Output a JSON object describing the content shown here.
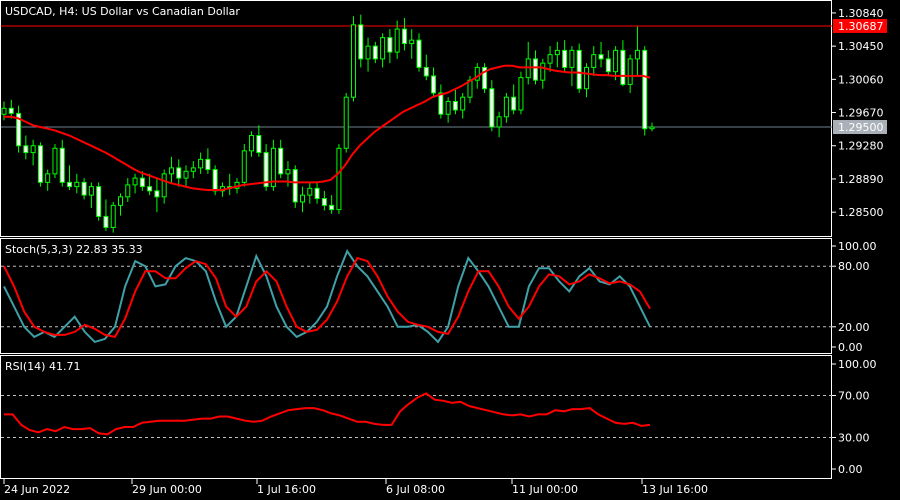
{
  "chart_data": [
    {
      "type": "candlestick",
      "symbol": "USDCAD",
      "timeframe": "H4",
      "title": "USDCAD, H4:  US Dollar vs Canadian Dollar",
      "ylim": [
        1.2822,
        1.3098
      ],
      "y_ticks": [
        "1.30840",
        "1.30450",
        "1.30060",
        "1.29670",
        "1.29280",
        "1.28890",
        "1.28500"
      ],
      "x_ticks": [
        "24 Jun 2022",
        "29 Jun 00:00",
        "1 Jul 16:00",
        "6 Jul 08:00",
        "11 Jul 00:00",
        "13 Jul 16:00"
      ],
      "bid_line": {
        "label": "1.29500",
        "value": 1.295
      },
      "ask_line": {
        "label": "1.30687",
        "value": 1.30687
      },
      "colors": {
        "bull_candle": "#00ff00",
        "ma_line": "#ff0000",
        "bid_line": "#708090",
        "ask_line": "#ff0000",
        "grid": "#c0c0c0"
      },
      "candles": [
        [
          1.2965,
          1.298,
          1.2958,
          1.2972
        ],
        [
          1.2972,
          1.2982,
          1.296,
          1.2966
        ],
        [
          1.2966,
          1.2975,
          1.292,
          1.2928
        ],
        [
          1.2928,
          1.294,
          1.2912,
          1.292
        ],
        [
          1.292,
          1.2935,
          1.2905,
          1.2928
        ],
        [
          1.2928,
          1.2932,
          1.288,
          1.2885
        ],
        [
          1.2885,
          1.29,
          1.2875,
          1.2895
        ],
        [
          1.2895,
          1.293,
          1.289,
          1.2925
        ],
        [
          1.2925,
          1.2935,
          1.288,
          1.2885
        ],
        [
          1.2885,
          1.2905,
          1.2876,
          1.288
        ],
        [
          1.288,
          1.2895,
          1.2872,
          1.2885
        ],
        [
          1.2885,
          1.289,
          1.2865,
          1.287
        ],
        [
          1.287,
          1.2885,
          1.2855,
          1.288
        ],
        [
          1.288,
          1.2885,
          1.284,
          1.2845
        ],
        [
          1.2845,
          1.2865,
          1.2828,
          1.2832
        ],
        [
          1.2832,
          1.2862,
          1.2826,
          1.2858
        ],
        [
          1.2858,
          1.2872,
          1.2846,
          1.2868
        ],
        [
          1.2868,
          1.289,
          1.2862,
          1.2882
        ],
        [
          1.2882,
          1.2895,
          1.2872,
          1.289
        ],
        [
          1.289,
          1.2898,
          1.2875,
          1.288
        ],
        [
          1.288,
          1.2895,
          1.287,
          1.2875
        ],
        [
          1.2875,
          1.289,
          1.285,
          1.2868
        ],
        [
          1.2868,
          1.29,
          1.286,
          1.2895
        ],
        [
          1.2895,
          1.2915,
          1.2885,
          1.2902
        ],
        [
          1.2902,
          1.2912,
          1.288,
          1.289
        ],
        [
          1.289,
          1.2905,
          1.288,
          1.2898
        ],
        [
          1.2898,
          1.291,
          1.289,
          1.2902
        ],
        [
          1.2902,
          1.292,
          1.2895,
          1.2912
        ],
        [
          1.2912,
          1.2925,
          1.2895,
          1.29
        ],
        [
          1.29,
          1.2905,
          1.287,
          1.2875
        ],
        [
          1.2875,
          1.2885,
          1.2868,
          1.288
        ],
        [
          1.288,
          1.2895,
          1.287,
          1.2878
        ],
        [
          1.2878,
          1.289,
          1.2872,
          1.2885
        ],
        [
          1.2885,
          1.293,
          1.288,
          1.2922
        ],
        [
          1.2922,
          1.2945,
          1.2915,
          1.294
        ],
        [
          1.294,
          1.2952,
          1.2915,
          1.292
        ],
        [
          1.292,
          1.293,
          1.2875,
          1.288
        ],
        [
          1.288,
          1.2935,
          1.2875,
          1.2925
        ],
        [
          1.2925,
          1.2935,
          1.289,
          1.2895
        ],
        [
          1.2895,
          1.291,
          1.288,
          1.29
        ],
        [
          1.29,
          1.2905,
          1.2855,
          1.2862
        ],
        [
          1.2862,
          1.288,
          1.285,
          1.287
        ],
        [
          1.287,
          1.2885,
          1.286,
          1.2878
        ],
        [
          1.2878,
          1.2885,
          1.286,
          1.2866
        ],
        [
          1.2866,
          1.2875,
          1.2852,
          1.2858
        ],
        [
          1.2858,
          1.287,
          1.2848,
          1.2853
        ],
        [
          1.2853,
          1.293,
          1.2848,
          1.2925
        ],
        [
          1.2925,
          1.299,
          1.292,
          1.2985
        ],
        [
          1.2985,
          1.308,
          1.298,
          1.307
        ],
        [
          1.307,
          1.3082,
          1.302,
          1.303
        ],
        [
          1.303,
          1.3055,
          1.3015,
          1.3045
        ],
        [
          1.3045,
          1.305,
          1.3025,
          1.303
        ],
        [
          1.303,
          1.306,
          1.302,
          1.3055
        ],
        [
          1.3055,
          1.3065,
          1.3025,
          1.3038
        ],
        [
          1.3038,
          1.3075,
          1.303,
          1.3065
        ],
        [
          1.3065,
          1.3078,
          1.304,
          1.3048
        ],
        [
          1.3048,
          1.3065,
          1.303,
          1.3052
        ],
        [
          1.3052,
          1.306,
          1.3015,
          1.302
        ],
        [
          1.302,
          1.3035,
          1.3005,
          1.301
        ],
        [
          1.301,
          1.302,
          1.2985,
          1.299
        ],
        [
          1.299,
          1.3,
          1.296,
          1.2965
        ],
        [
          1.2965,
          1.2985,
          1.2955,
          1.298
        ],
        [
          1.298,
          1.2995,
          1.2965,
          1.297
        ],
        [
          1.297,
          1.299,
          1.296,
          1.2985
        ],
        [
          1.2985,
          1.301,
          1.2978,
          1.3005
        ],
        [
          1.3005,
          1.3025,
          1.2995,
          1.302
        ],
        [
          1.302,
          1.3025,
          1.299,
          1.2995
        ],
        [
          1.2995,
          1.3005,
          1.2945,
          1.295
        ],
        [
          1.295,
          1.2968,
          1.2938,
          1.2962
        ],
        [
          1.2962,
          1.299,
          1.2955,
          1.2985
        ],
        [
          1.2985,
          1.3,
          1.2965,
          1.297
        ],
        [
          1.297,
          1.3015,
          1.2965,
          1.3008
        ],
        [
          1.3008,
          1.305,
          1.3,
          1.303
        ],
        [
          1.303,
          1.304,
          1.3,
          1.3005
        ],
        [
          1.3005,
          1.303,
          1.2995,
          1.3025
        ],
        [
          1.3025,
          1.3045,
          1.3015,
          1.3035
        ],
        [
          1.3035,
          1.305,
          1.302,
          1.304
        ],
        [
          1.304,
          1.3052,
          1.3015,
          1.302
        ],
        [
          1.302,
          1.3045,
          1.2998,
          1.304
        ],
        [
          1.304,
          1.3048,
          1.299,
          1.2995
        ],
        [
          1.2995,
          1.3025,
          1.2985,
          1.302
        ],
        [
          1.302,
          1.3045,
          1.301,
          1.3035
        ],
        [
          1.3035,
          1.305,
          1.302,
          1.303
        ],
        [
          1.303,
          1.304,
          1.301,
          1.3015
        ],
        [
          1.3015,
          1.3045,
          1.3005,
          1.304
        ],
        [
          1.304,
          1.3052,
          1.2998,
          1.3
        ],
        [
          1.3,
          1.3035,
          1.299,
          1.303
        ],
        [
          1.303,
          1.3068,
          1.301,
          1.304
        ],
        [
          1.304,
          1.3045,
          1.294,
          1.2948
        ],
        [
          1.2948,
          1.2955,
          1.2945,
          1.295
        ]
      ],
      "ma_values": [
        1.2962,
        1.2962,
        1.296,
        1.2956,
        1.2952,
        1.295,
        1.2948,
        1.2946,
        1.2943,
        1.294,
        1.2936,
        1.2932,
        1.2928,
        1.2924,
        1.292,
        1.2915,
        1.291,
        1.2905,
        1.29,
        1.2896,
        1.2893,
        1.289,
        1.2887,
        1.2884,
        1.2882,
        1.288,
        1.2878,
        1.2877,
        1.2876,
        1.2876,
        1.2876,
        1.2878,
        1.288,
        1.2882,
        1.2883,
        1.2884,
        1.2885,
        1.2886,
        1.2886,
        1.2886,
        1.2885,
        1.2885,
        1.2885,
        1.2885,
        1.2886,
        1.2888,
        1.2895,
        1.2905,
        1.2918,
        1.2928,
        1.2936,
        1.2944,
        1.295,
        1.2956,
        1.2962,
        1.2968,
        1.2972,
        1.2976,
        1.298,
        1.2985,
        1.2988,
        1.299,
        1.2994,
        1.2998,
        1.3003,
        1.3008,
        1.3014,
        1.3018,
        1.302,
        1.3022,
        1.3022,
        1.302,
        1.302,
        1.302,
        1.302,
        1.3018,
        1.3016,
        1.3015,
        1.3014,
        1.3014,
        1.3013,
        1.3012,
        1.3011,
        1.3011,
        1.301,
        1.301,
        1.301,
        1.301,
        1.301,
        1.3008
      ]
    },
    {
      "type": "line",
      "title": "Stoch(5,3,3) 22.83 35.33",
      "ylim": [
        0,
        100
      ],
      "y_ticks": [
        "100.00",
        "80.00",
        "20.00",
        "0.00"
      ],
      "levels": [
        80,
        20
      ],
      "series": [
        {
          "color": "#40a0a8",
          "values": [
            60,
            40,
            20,
            10,
            15,
            10,
            20,
            30,
            15,
            5,
            8,
            20,
            60,
            85,
            80,
            60,
            62,
            80,
            88,
            85,
            75,
            45,
            20,
            30,
            60,
            90,
            70,
            40,
            20,
            10,
            15,
            25,
            40,
            70,
            95,
            80,
            70,
            55,
            40,
            20,
            20,
            22,
            15,
            5,
            20,
            60,
            88,
            75,
            60,
            40,
            20,
            20,
            60,
            78,
            78,
            65,
            55,
            70,
            78,
            65,
            62,
            70,
            60,
            40,
            20
          ]
        },
        {
          "color": "#ff0000",
          "values": [
            80,
            60,
            35,
            20,
            15,
            12,
            12,
            15,
            22,
            18,
            12,
            10,
            28,
            55,
            75,
            75,
            68,
            68,
            78,
            85,
            82,
            68,
            40,
            30,
            40,
            65,
            75,
            65,
            40,
            20,
            15,
            17,
            27,
            45,
            70,
            88,
            85,
            70,
            50,
            35,
            25,
            22,
            20,
            15,
            13,
            30,
            55,
            75,
            75,
            60,
            40,
            28,
            40,
            60,
            72,
            70,
            62,
            65,
            72,
            68,
            63,
            65,
            62,
            55,
            38
          ]
        }
      ]
    },
    {
      "type": "line",
      "title": "RSI(14) 41.71",
      "ylim": [
        0,
        100
      ],
      "y_ticks": [
        "100.00",
        "70.00",
        "30.00",
        "0.00"
      ],
      "levels": [
        70,
        30
      ],
      "series": [
        {
          "color": "#ff0000",
          "values": [
            52,
            52,
            42,
            37,
            35,
            38,
            36,
            40,
            38,
            38,
            39,
            34,
            33,
            38,
            40,
            40,
            44,
            45,
            46,
            46,
            46,
            46,
            47,
            48,
            48,
            50,
            50,
            48,
            46,
            45,
            46,
            50,
            53,
            56,
            57,
            58,
            58,
            56,
            53,
            51,
            48,
            45,
            45,
            43,
            42,
            42,
            55,
            62,
            68,
            72,
            66,
            65,
            63,
            64,
            60,
            58,
            56,
            54,
            52,
            51,
            52,
            50,
            52,
            52,
            56,
            55,
            57,
            57,
            58,
            52,
            48,
            44,
            43,
            44,
            41,
            42
          ]
        }
      ]
    }
  ]
}
